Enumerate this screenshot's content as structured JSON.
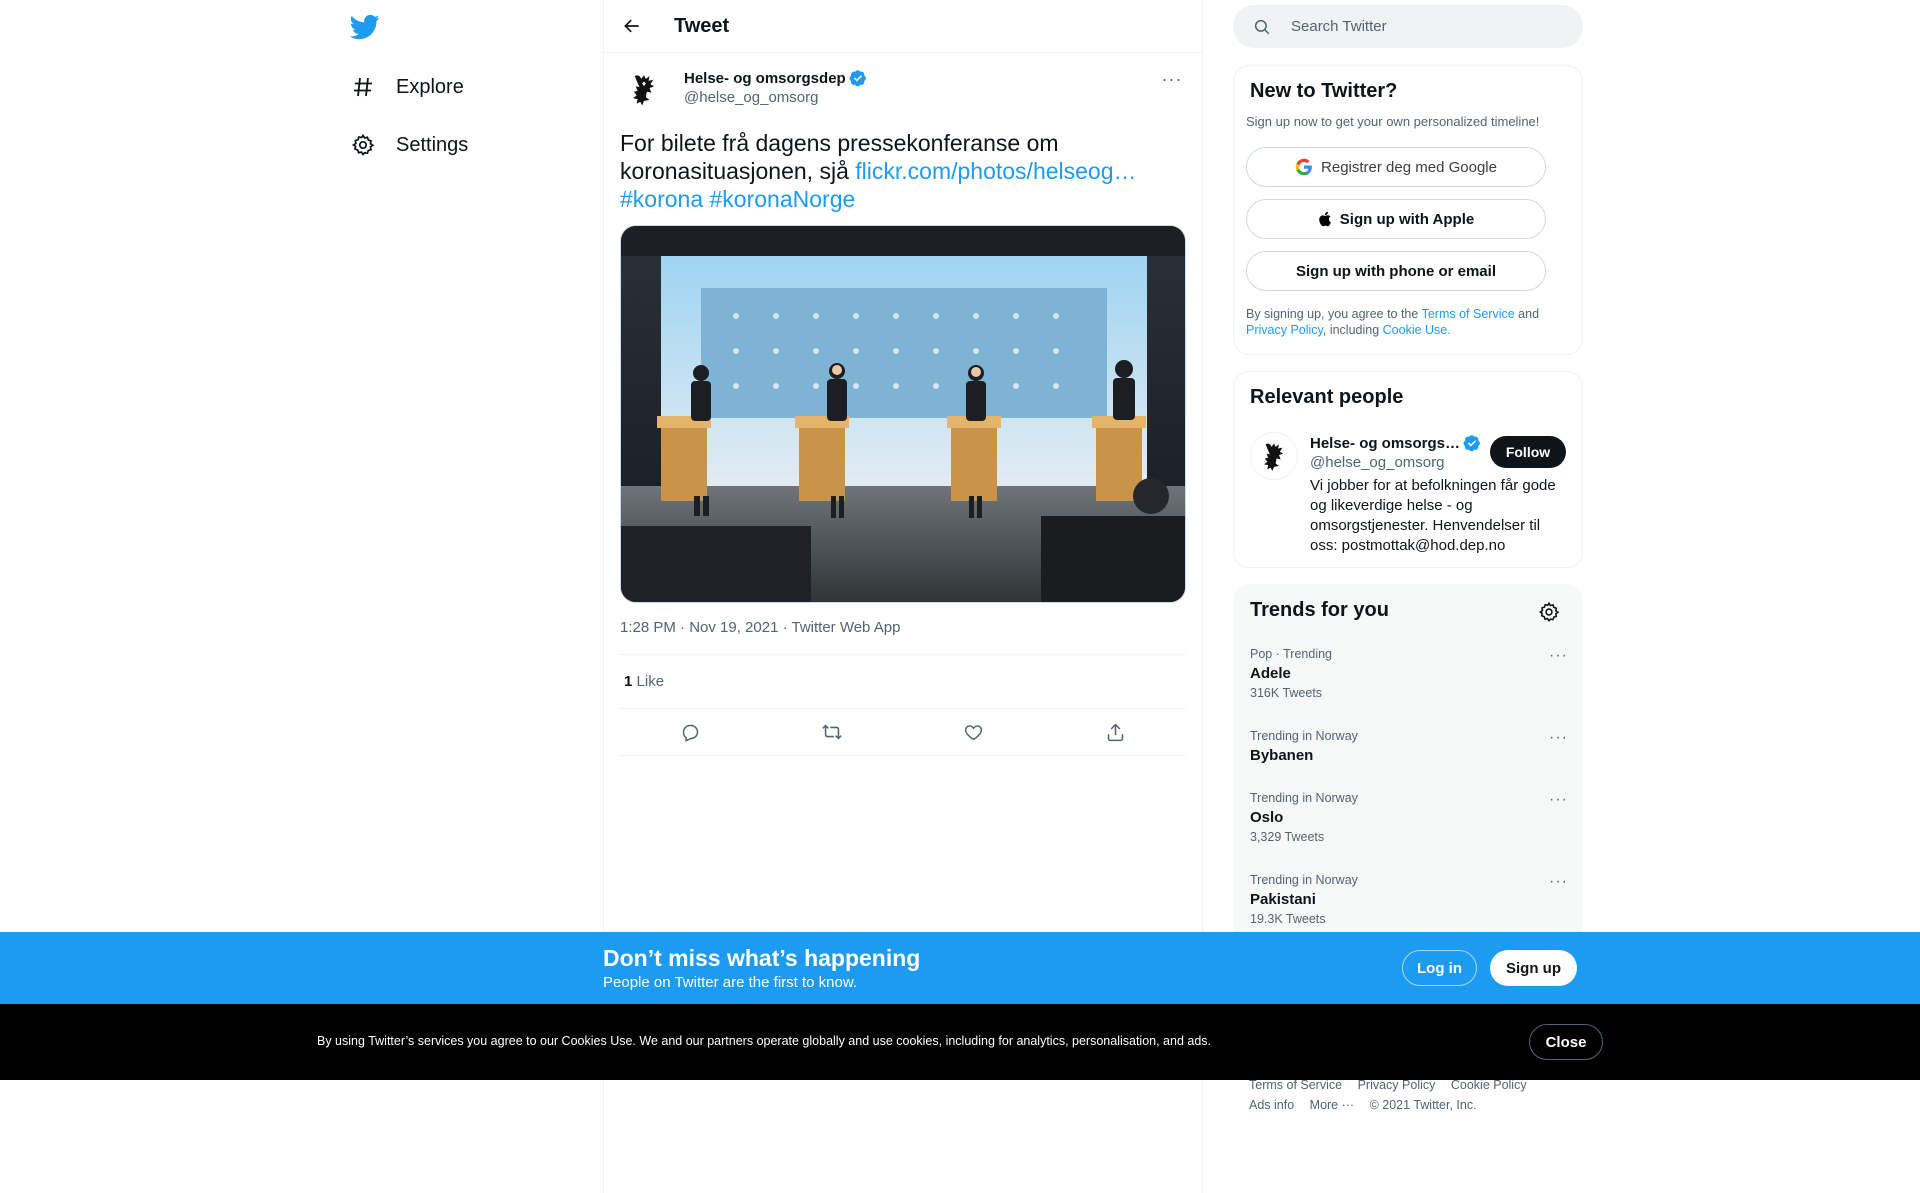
{
  "nav": {
    "items": [
      {
        "label": "Explore",
        "icon": "hashtag-icon"
      },
      {
        "label": "Settings",
        "icon": "gear-icon"
      }
    ]
  },
  "header": {
    "title": "Tweet"
  },
  "tweet": {
    "author_name": "Helse- og omsorgsdep",
    "author_handle": "@helse_og_omsorg",
    "text_plain": "For bilete frå dagens pressekonferanse om koronasituasjonen, sjå ",
    "link": "flickr.com/photos/helseog…",
    "hashtag1": "#korona",
    "hashtag2": "#koronaNorge",
    "timestamp": "1:28 PM · Nov 19, 2021 · Twitter Web App",
    "like_count": "1",
    "like_label": "Like"
  },
  "search": {
    "placeholder": "Search Twitter"
  },
  "signup": {
    "title": "New to Twitter?",
    "subtitle": "Sign up now to get your own personalized timeline!",
    "google": "Registrer deg med Google",
    "apple": "Sign up with Apple",
    "phone": "Sign up with phone or email",
    "legal_1": "By signing up, you agree to the ",
    "tos": "Terms of Service",
    "legal_2": " and ",
    "privacy": "Privacy Policy",
    "legal_3": ", including ",
    "cookie": "Cookie Use."
  },
  "people": {
    "title": "Relevant people",
    "name": "Helse- og omsorgs…",
    "handle": "@helse_og_omsorg",
    "follow": "Follow",
    "bio": "Vi jobber for at befolkningen får gode og likeverdige helse - og omsorgstjenester. Henvendelser til oss: postmottak@hod.dep.no"
  },
  "trends": {
    "title": "Trends for you",
    "items": [
      {
        "context": "Pop · Trending",
        "name": "Adele",
        "count": "316K Tweets"
      },
      {
        "context": "Trending in Norway",
        "name": "Bybanen",
        "count": ""
      },
      {
        "context": "Trending in Norway",
        "name": "Oslo",
        "count": "3,329 Tweets"
      },
      {
        "context": "Trending in Norway",
        "name": "Pakistani",
        "count": "19.3K Tweets"
      }
    ]
  },
  "footer": {
    "tos": "Terms of Service",
    "privacy": "Privacy Policy",
    "cookie": "Cookie Policy",
    "ads": "Ads info",
    "more": "More ···",
    "copyright": "© 2021 Twitter, Inc."
  },
  "banner": {
    "heading": "Don’t miss what’s happening",
    "sub": "People on Twitter are the first to know.",
    "login": "Log in",
    "signup": "Sign up"
  },
  "cookies": {
    "text": "By using Twitter’s services you agree to our Cookies Use. We and our partners operate globally and use cookies, including for analytics, personalisation, and ads.",
    "close": "Close"
  },
  "colors": {
    "accent": "#1d9bf0",
    "text": "#0f1419",
    "secondary": "#536471"
  }
}
